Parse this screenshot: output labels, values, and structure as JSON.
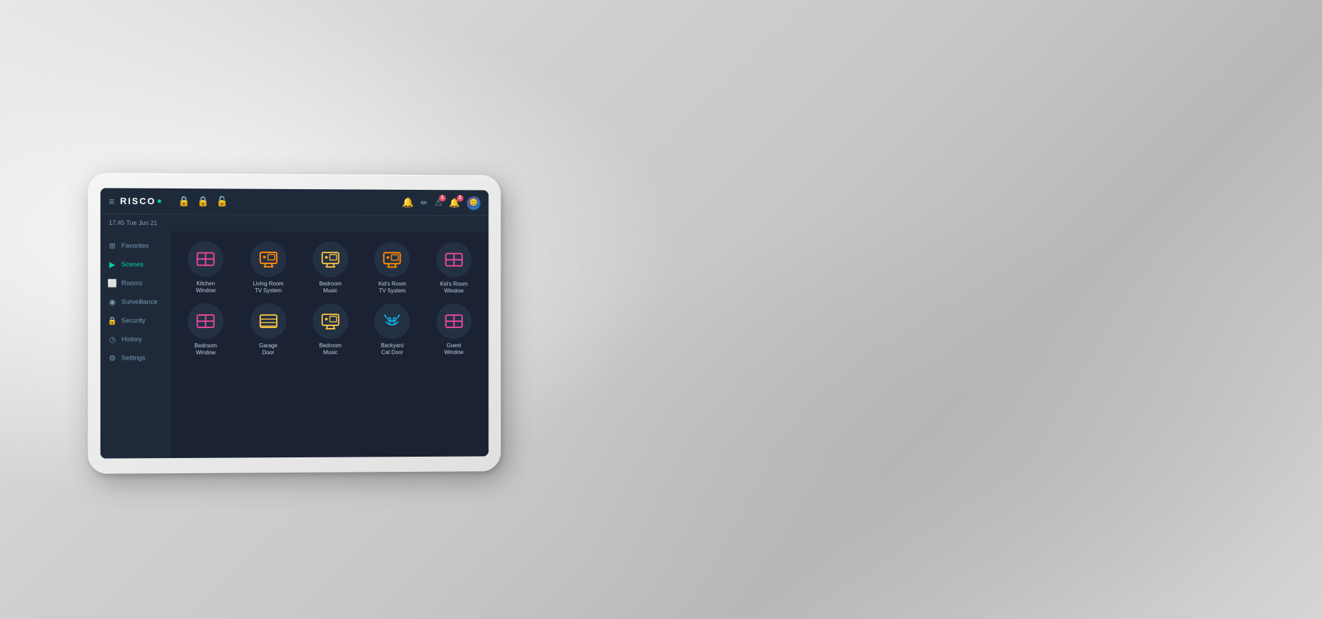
{
  "app": {
    "name": "RISCO",
    "datetime": "17:45  Tue Jun 21"
  },
  "header": {
    "menu_label": "☰",
    "logo_text": "RISCO",
    "locks": [
      {
        "icon": "🔒",
        "color": "#e84899",
        "id": "lock1"
      },
      {
        "icon": "🔒",
        "color": "#f0c040",
        "id": "lock2"
      },
      {
        "icon": "🔒",
        "color": "#00d4aa",
        "id": "lock3"
      }
    ],
    "actions": [
      {
        "icon": "🔔",
        "id": "notifications",
        "badge": null
      },
      {
        "icon": "✏️",
        "id": "edit",
        "badge": null
      },
      {
        "icon": "⚠️",
        "id": "alerts",
        "badge": "1"
      },
      {
        "icon": "🔔",
        "id": "bell",
        "badge": "2"
      },
      {
        "icon": "👤",
        "id": "user",
        "badge": null
      }
    ]
  },
  "sidebar": {
    "items": [
      {
        "id": "favorites",
        "label": "Favorites",
        "icon": "⊞",
        "active": false
      },
      {
        "id": "scenes",
        "label": "Scenes",
        "icon": "▶",
        "active": true
      },
      {
        "id": "rooms",
        "label": "Rooms",
        "icon": "⬜",
        "active": false
      },
      {
        "id": "surveillance",
        "label": "Surveillance",
        "icon": "◉",
        "active": false
      },
      {
        "id": "security",
        "label": "Security",
        "icon": "🔒",
        "active": false
      },
      {
        "id": "history",
        "label": "History",
        "icon": "◷",
        "active": false
      },
      {
        "id": "settings",
        "label": "Settings",
        "icon": "⚙",
        "active": false
      }
    ]
  },
  "scenes": {
    "grid": [
      {
        "id": "kitchen-window",
        "label": "Kitchen\nWindow",
        "icon": "▣",
        "icon_color": "pink"
      },
      {
        "id": "living-room-tv",
        "label": "Living Room\nTV System",
        "icon": "📺",
        "icon_color": "orange"
      },
      {
        "id": "bedroom-music-1",
        "label": "Bedroom\nMusic",
        "icon": "📺",
        "icon_color": "yellow"
      },
      {
        "id": "kids-room-tv",
        "label": "Kid's Room\nTV System",
        "icon": "📺",
        "icon_color": "orange"
      },
      {
        "id": "kids-room-window",
        "label": "Kid's Room\nWindow",
        "icon": "▣",
        "icon_color": "pink"
      },
      {
        "id": "bedroom-window",
        "label": "Bedroom\nWindow",
        "icon": "▣",
        "icon_color": "pink"
      },
      {
        "id": "garage-door",
        "label": "Garage\nDoor",
        "icon": "⬜",
        "icon_color": "yellow"
      },
      {
        "id": "bedroom-music-2",
        "label": "Bedroom\nMusic",
        "icon": "⬜",
        "icon_color": "yellow"
      },
      {
        "id": "backyard-cat-door",
        "label": "Backyard\nCat Door",
        "icon": "🐱",
        "icon_color": "cyan"
      },
      {
        "id": "guest-window",
        "label": "Guest\nWindow",
        "icon": "▣",
        "icon_color": "pink"
      }
    ]
  }
}
